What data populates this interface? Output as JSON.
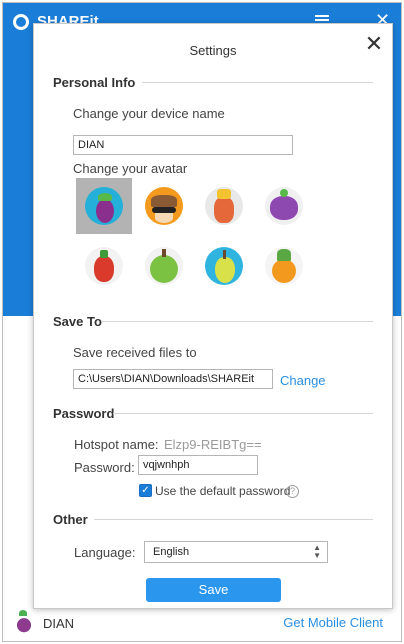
{
  "app": {
    "logo_text": "SHAREit",
    "user_name": "DIAN",
    "mobile_link": "Get Mobile Client"
  },
  "dialog": {
    "title": "Settings",
    "close_label": "✕",
    "personal_info": {
      "heading": "Personal Info",
      "device_name_label": "Change your device name",
      "device_name_value": "DIAN",
      "avatar_label": "Change your avatar",
      "avatars": [
        {
          "name": "eggplant",
          "selected": true
        },
        {
          "name": "sunglasses-fruit",
          "selected": false
        },
        {
          "name": "carrot",
          "selected": false
        },
        {
          "name": "grapes",
          "selected": false
        },
        {
          "name": "pepper",
          "selected": false
        },
        {
          "name": "apple",
          "selected": false
        },
        {
          "name": "pear",
          "selected": false
        },
        {
          "name": "pineapple",
          "selected": false
        }
      ]
    },
    "save_to": {
      "heading": "Save To",
      "label": "Save received files to",
      "path": "C:\\Users\\DIAN\\Downloads\\SHAREit",
      "change_label": "Change"
    },
    "password": {
      "heading": "Password",
      "hotspot_label": "Hotspot name:",
      "hotspot_value": "Elzp9-REIBTg==",
      "password_label": "Password:",
      "password_value": "vqjwnhph",
      "default_checkbox_label": "Use the default password",
      "default_checked": true,
      "help_icon": "?"
    },
    "other": {
      "heading": "Other",
      "language_label": "Language:",
      "language_value": "English"
    },
    "save_label": "Save"
  },
  "colors": {
    "brand_blue": "#1a7ed9",
    "button_blue": "#2a96ee",
    "link_blue": "#2a8ee0"
  }
}
